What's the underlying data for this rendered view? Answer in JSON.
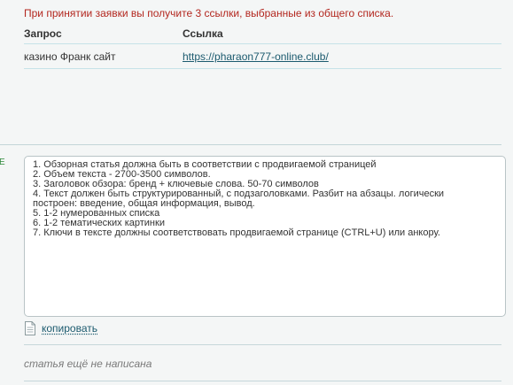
{
  "notice": "При принятии заявки вы получите 3 ссылки, выбранные из общего списка.",
  "table": {
    "columns": [
      "Запрос",
      "Ссылка"
    ],
    "rows": [
      {
        "query": "казино Франк сайт",
        "link": "https://pharaon777-online.club/"
      }
    ]
  },
  "left_marker": "E",
  "requirements": [
    "1. Обзорная статья должна быть в соответствии с продвигаемой страницей",
    "2. Объем текста - 2700-3500 символов.",
    "3. Заголовок обзора: бренд + ключевые слова. 50-70 символов",
    "4. Текст должен быть структурированный, с подзаголовками. Разбит на абзацы. логически",
    "построен: введение, общая информация, вывод.",
    "5. 1-2 нумерованных списка",
    "6. 1-2 тематических картинки",
    "7. Ключи в тексте должны соответствовать продвигаемой странице (CTRL+U) или анкору."
  ],
  "copy": {
    "label": "копировать",
    "icon": "document-icon"
  },
  "status": "статья ещё не написана",
  "colors": {
    "notice": "#b3271f",
    "link": "#1b5a6e",
    "background": "#f4f6f6",
    "marker": "#2e8a3c"
  }
}
